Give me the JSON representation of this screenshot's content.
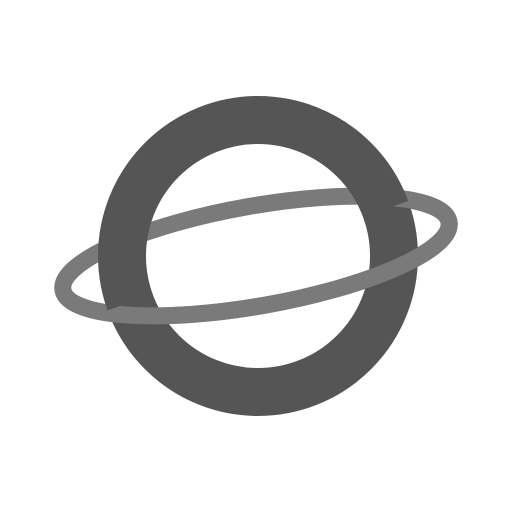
{
  "icon": {
    "name": "planet-icon",
    "colors": {
      "background": "#ffffff",
      "body": "#555555",
      "ring": "#7a7a7a"
    }
  }
}
